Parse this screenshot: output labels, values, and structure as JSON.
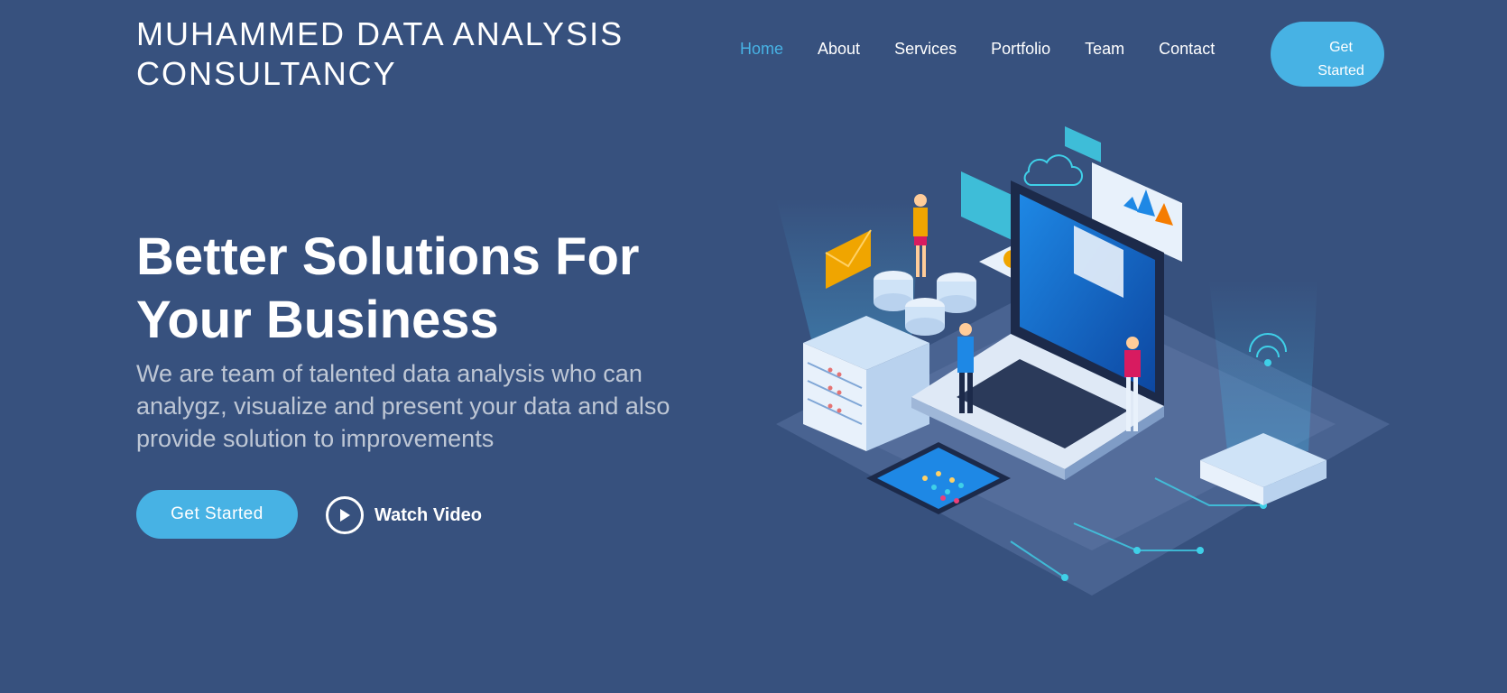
{
  "brand": {
    "name": "MUHAMMED DATA ANALYSIS CONSULTANCY"
  },
  "nav": {
    "items": [
      {
        "label": "Home",
        "active": true
      },
      {
        "label": "About"
      },
      {
        "label": "Services"
      },
      {
        "label": "Portfolio"
      },
      {
        "label": "Team"
      },
      {
        "label": "Contact"
      }
    ],
    "cta_line1": "Get",
    "cta_line2": "Started"
  },
  "hero": {
    "title_line1": "Better Solutions For",
    "title_line2": "Your Business",
    "subtitle": "We are team of talented data analysis who can analygz, visualize and present your data and also provide solution to improvements",
    "primary_button": "Get Started",
    "video_button": "Watch Video"
  },
  "colors": {
    "background": "#37517e",
    "accent": "#47b2e4",
    "text": "#ffffff"
  },
  "illustration": {
    "icons": [
      "cloud-icon",
      "envelope-icon",
      "wifi-icon",
      "laptop-icon",
      "server-icon",
      "smartphone-icon",
      "database-icon",
      "chart-icon"
    ]
  }
}
